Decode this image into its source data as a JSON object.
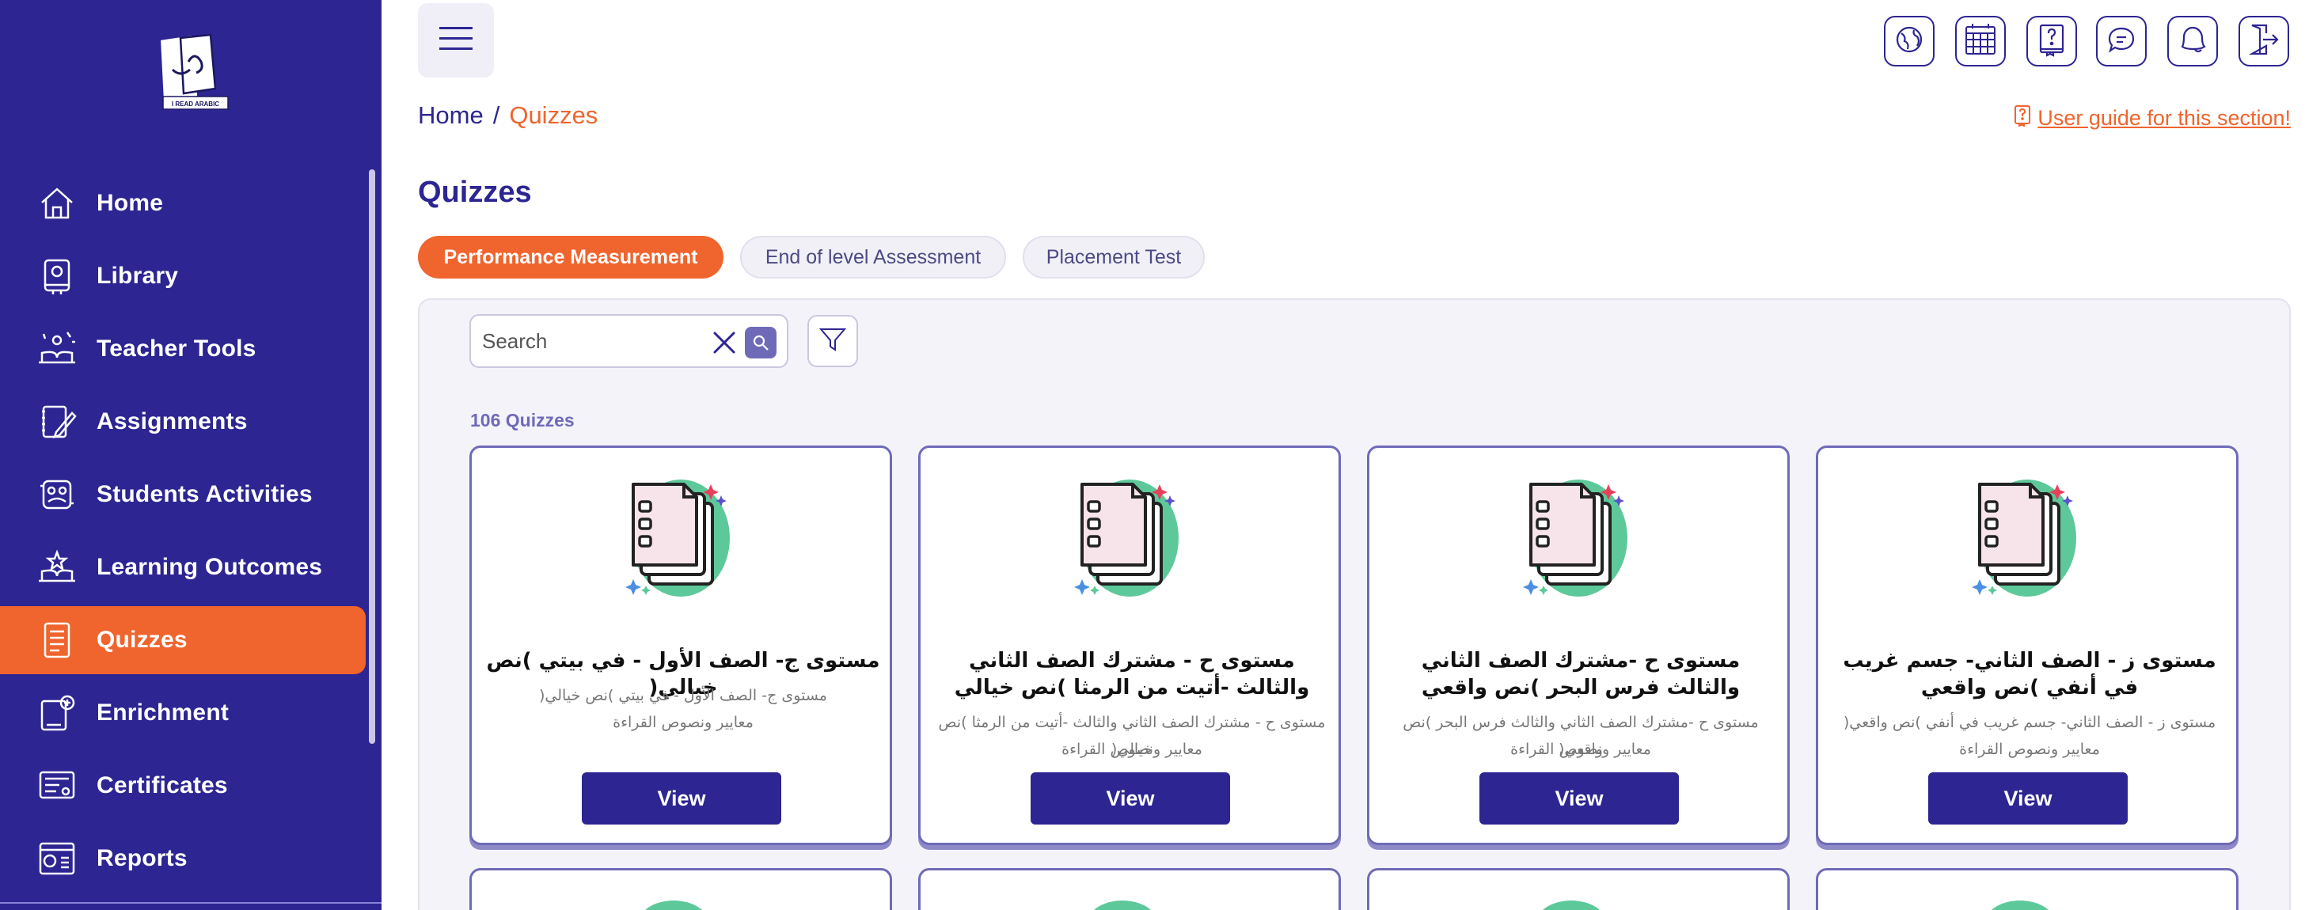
{
  "sidebar": {
    "logo_text": "I READ ARABIC",
    "items": [
      {
        "label": "Home",
        "icon": "home-icon",
        "active": false
      },
      {
        "label": "Library",
        "icon": "library-icon",
        "active": false
      },
      {
        "label": "Teacher Tools",
        "icon": "teacher-tools-icon",
        "active": false
      },
      {
        "label": "Assignments",
        "icon": "assignments-icon",
        "active": false
      },
      {
        "label": "Students Activities",
        "icon": "students-activities-icon",
        "active": false
      },
      {
        "label": "Learning Outcomes",
        "icon": "learning-outcomes-icon",
        "active": false
      },
      {
        "label": "Quizzes",
        "icon": "quizzes-icon",
        "active": true
      },
      {
        "label": "Enrichment",
        "icon": "enrichment-icon",
        "active": false
      },
      {
        "label": "Certificates",
        "icon": "certificates-icon",
        "active": false
      },
      {
        "label": "Reports",
        "icon": "reports-icon",
        "active": false
      }
    ]
  },
  "topbar": {
    "icons": [
      "globe-icon",
      "calendar-icon",
      "help-book-icon",
      "chat-icon",
      "notification-bell-icon",
      "logout-icon"
    ]
  },
  "breadcrumb": {
    "home": "Home",
    "separator": "/",
    "current": "Quizzes"
  },
  "guide_link": "User guide for this section!",
  "page_title": "Quizzes",
  "tabs": [
    {
      "label": "Performance Measurement",
      "active": true
    },
    {
      "label": "End of level Assessment",
      "active": false
    },
    {
      "label": "Placement Test",
      "active": false
    }
  ],
  "search": {
    "placeholder": "Search",
    "value": ""
  },
  "count_label": "106 Quizzes",
  "cards": [
    {
      "title": "مستوى ج- الصف الأول - في بيتي )نص خيالي(",
      "sub1": "مستوى ج- الصف الأول - في بيتي )نص خيالي(",
      "sub2": "معايير ونصوص القراءة",
      "button": "View"
    },
    {
      "title": "مستوى ح - مشترك الصف الثاني والثالث -أتيت من الرمثا )نص خيالي",
      "sub1": "مستوى ح - مشترك الصف الثاني والثالث -أتيت من الرمثا )نص خيالي(",
      "sub2": "معايير ونصوص القراءة",
      "button": "View"
    },
    {
      "title": "مستوى ح -مشترك الصف الثاني والثالث فرس البحر )نص واقعي",
      "sub1": "مستوى ح -مشترك الصف الثاني والثالث فرس البحر )نص واقعي(",
      "sub2": "معايير ونصوص القراءة",
      "button": "View"
    },
    {
      "title": "مستوى ز - الصف الثاني- جسم غريب في أنفي )نص واقعي",
      "sub1": "مستوى ز - الصف الثاني- جسم غريب في أنفي )نص واقعي(",
      "sub2": "معايير ونصوص القراءة",
      "button": "View"
    }
  ],
  "colors": {
    "brand": "#2d2592",
    "accent": "#f0642e",
    "blob": "#5dc99a"
  }
}
